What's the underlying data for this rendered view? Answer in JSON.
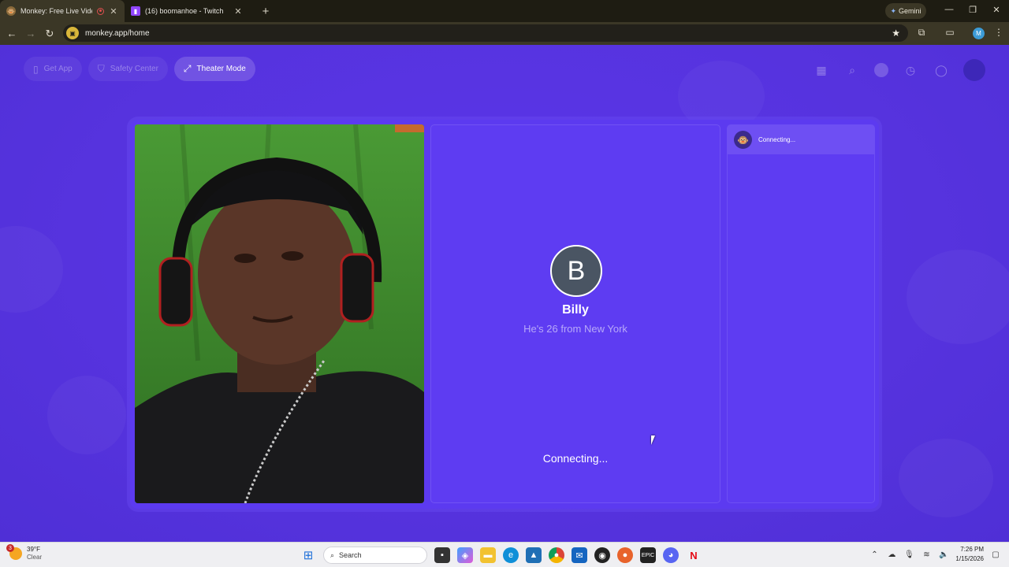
{
  "browser": {
    "tabs": [
      {
        "title": "Monkey: Free Live Video Ch",
        "active": true
      },
      {
        "title": "(16) boomanhoe - Twitch",
        "active": false
      }
    ],
    "gemini_label": "Gemini",
    "url": "monkey.app/home",
    "profile_initial": "M"
  },
  "topnav": {
    "get_app": "Get App",
    "safety_center": "Safety Center",
    "theater_mode": "Theater Mode"
  },
  "peer": {
    "initial": "B",
    "name": "Billy",
    "description": "He's 26 from New York",
    "status": "Connecting..."
  },
  "chat": {
    "status": "Connecting..."
  },
  "taskbar": {
    "weather_temp": "39°F",
    "weather_desc": "Clear",
    "weather_badge": "3",
    "search_placeholder": "Search",
    "time": "7:26 PM",
    "date": "1/15/2026"
  },
  "colors": {
    "page_bg": "#5a35e0",
    "panel_bg": "#5e3cf2",
    "avatar_bg": "#4a5563"
  }
}
